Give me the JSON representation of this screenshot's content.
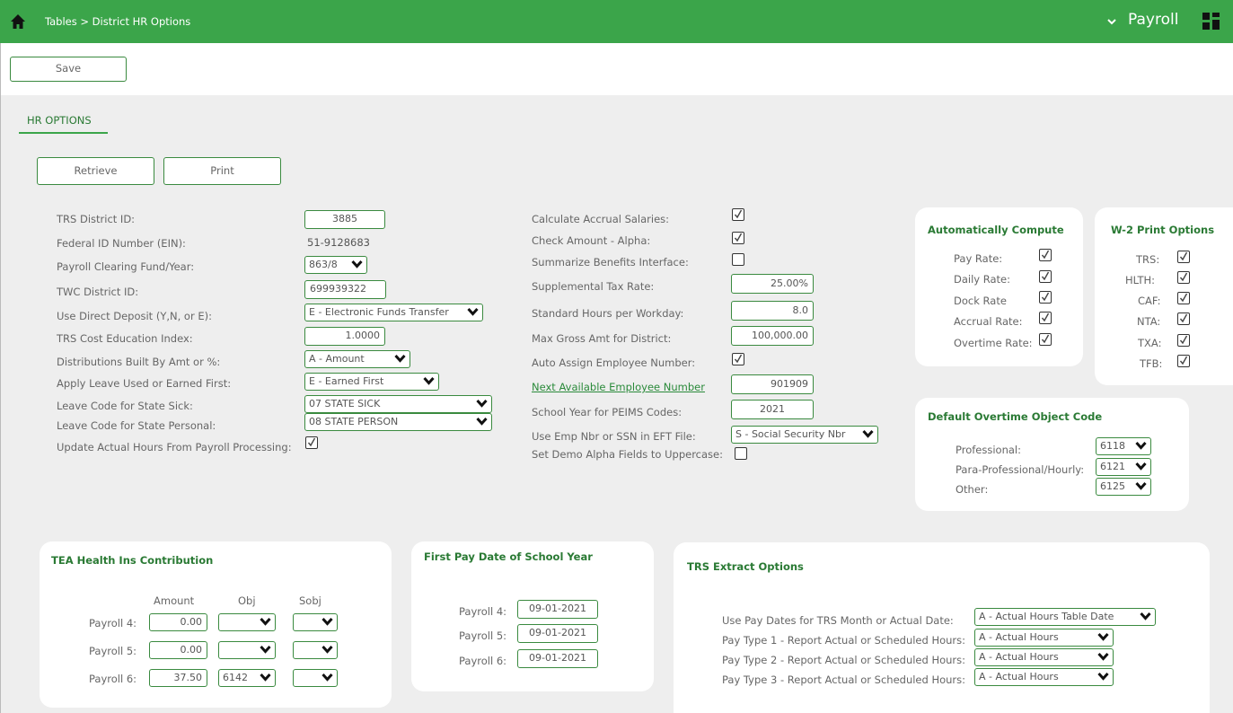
{
  "topbar": {
    "breadcrumb": "Tables > District HR Options",
    "module": "Payroll"
  },
  "toolbar": {
    "save_label": "Save"
  },
  "tab": {
    "label": "HR OPTIONS"
  },
  "actions": {
    "retrieve_label": "Retrieve",
    "print_label": "Print"
  },
  "left_fields": {
    "trs_district_id": {
      "label": "TRS District ID:",
      "value": "3885"
    },
    "federal_id": {
      "label": "Federal ID Number (EIN):",
      "value": "51-9128683"
    },
    "clearing_fund": {
      "label": "Payroll Clearing Fund/Year:",
      "value": "863/8"
    },
    "twc_district_id": {
      "label": "TWC District ID:",
      "value": "699939322"
    },
    "direct_deposit": {
      "label": "Use Direct Deposit (Y,N, or E):",
      "value": "E - Electronic Funds Transfer"
    },
    "trs_cost_index": {
      "label": "TRS Cost Education Index:",
      "value": "1.0000"
    },
    "distributions": {
      "label": "Distributions Built By Amt or %:",
      "value": "A - Amount"
    },
    "apply_leave": {
      "label": "Apply Leave Used or Earned First:",
      "value": "E - Earned First"
    },
    "leave_sick": {
      "label": "Leave Code for State Sick:",
      "value": "07 STATE SICK"
    },
    "leave_personal": {
      "label": "Leave Code for State Personal:",
      "value": "08 STATE PERSON"
    },
    "update_hours": {
      "label": "Update Actual Hours From Payroll Processing:",
      "checked": true
    }
  },
  "mid_fields": {
    "calc_accrual": {
      "label": "Calculate Accrual Salaries:",
      "checked": true
    },
    "check_alpha": {
      "label": "Check Amount - Alpha:",
      "checked": true
    },
    "summarize_benefits": {
      "label": "Summarize Benefits Interface:",
      "checked": false
    },
    "supp_tax": {
      "label": "Supplemental Tax Rate:",
      "value": "25.00%"
    },
    "std_hours": {
      "label": "Standard Hours per Workday:",
      "value": "8.0"
    },
    "max_gross": {
      "label": "Max Gross Amt for District:",
      "value": "100,000.00"
    },
    "auto_assign": {
      "label": "Auto Assign Employee Number:",
      "checked": true
    },
    "next_emp": {
      "label": "Next Available Employee Number",
      "value": "901909"
    },
    "school_year": {
      "label": "School Year for PEIMS Codes:",
      "value": "2021"
    },
    "eft": {
      "label": "Use Emp Nbr or SSN in EFT File:",
      "value": "S - Social Security Nbr"
    },
    "demo_upper": {
      "label": "Set Demo Alpha Fields to Uppercase:",
      "checked": false
    }
  },
  "auto_compute": {
    "title": "Automatically Compute",
    "items": [
      {
        "label": "Pay Rate:",
        "checked": true
      },
      {
        "label": "Daily Rate:",
        "checked": true
      },
      {
        "label": "Dock Rate",
        "checked": true
      },
      {
        "label": "Accrual Rate:",
        "checked": true
      },
      {
        "label": "Overtime Rate:",
        "checked": true
      }
    ]
  },
  "w2_print": {
    "title": "W-2 Print Options",
    "items": [
      {
        "label": "TRS:",
        "checked": true
      },
      {
        "label": "HLTH:",
        "checked": true
      },
      {
        "label": "CAF:",
        "checked": true
      },
      {
        "label": "NTA:",
        "checked": true
      },
      {
        "label": "TXA:",
        "checked": true
      },
      {
        "label": "TFB:",
        "checked": true
      }
    ]
  },
  "overtime": {
    "title": "Default Overtime Object Code",
    "items": [
      {
        "label": "Professional:",
        "value": "6118"
      },
      {
        "label": "Para-Professional/Hourly:",
        "value": "6121"
      },
      {
        "label": "Other:",
        "value": "6125"
      }
    ]
  },
  "tea_health": {
    "title": "TEA Health Ins Contribution",
    "headers": {
      "amount": "Amount",
      "obj": "Obj",
      "sobj": "Sobj"
    },
    "rows": [
      {
        "label": "Payroll 4:",
        "amount": "0.00",
        "obj": "",
        "sobj": ""
      },
      {
        "label": "Payroll 5:",
        "amount": "0.00",
        "obj": "",
        "sobj": ""
      },
      {
        "label": "Payroll 6:",
        "amount": "37.50",
        "obj": "6142",
        "sobj": ""
      }
    ]
  },
  "first_pay": {
    "title": "First Pay Date of School Year",
    "rows": [
      {
        "label": "Payroll 4:",
        "value": "09-01-2021"
      },
      {
        "label": "Payroll 5:",
        "value": "09-01-2021"
      },
      {
        "label": "Payroll 6:",
        "value": "09-01-2021"
      }
    ]
  },
  "trs_extract": {
    "title": "TRS Extract Options",
    "rows": [
      {
        "label": "Use Pay Dates for TRS Month or Actual Date:",
        "value": "A - Actual Hours Table Date"
      },
      {
        "label": "Pay Type 1 - Report Actual or Scheduled Hours:",
        "value": "A - Actual Hours"
      },
      {
        "label": "Pay Type 2 - Report Actual or Scheduled Hours:",
        "value": "A - Actual Hours"
      },
      {
        "label": "Pay Type 3 - Report Actual or Scheduled Hours:",
        "value": "A - Actual Hours"
      }
    ]
  }
}
